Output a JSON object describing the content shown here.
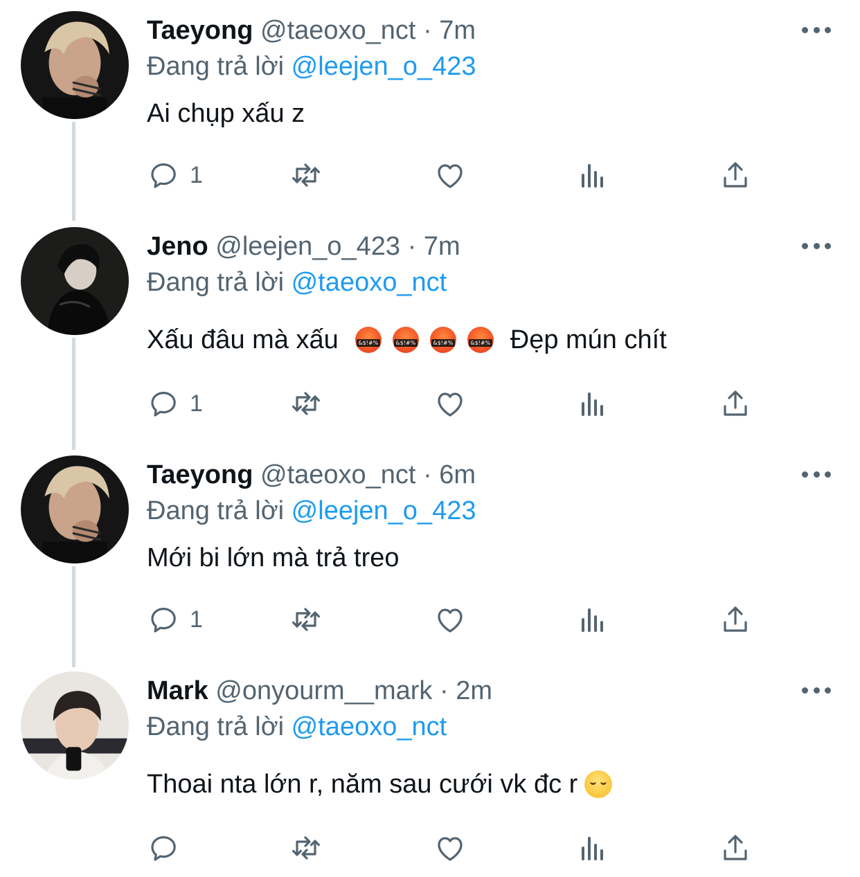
{
  "colors": {
    "link": "#1d9bf0",
    "muted": "#536471",
    "text": "#0f1419",
    "thread_line": "#cfd9de"
  },
  "tweets": [
    {
      "name": "Taeyong",
      "handle": "@taeoxo_nct",
      "dot": "·",
      "time": "7m",
      "reply_prefix": "Đang trả lời",
      "reply_to": "@leejen_o_423",
      "text_before": "Ai chụp xấu z",
      "emojis": [],
      "text_after": "",
      "reply_count": "1",
      "avatar": "taeyong-avatar"
    },
    {
      "name": "Jeno",
      "handle": "@leejen_o_423",
      "dot": "·",
      "time": "7m",
      "reply_prefix": "Đang trả lời",
      "reply_to": "@taeoxo_nct",
      "text_before": "Xấu đâu mà xấu",
      "emojis": [
        "face-with-symbols-on-mouth",
        "face-with-symbols-on-mouth",
        "face-with-symbols-on-mouth",
        "face-with-symbols-on-mouth"
      ],
      "text_after": "Đẹp mún chít",
      "reply_count": "1",
      "avatar": "jeno-avatar"
    },
    {
      "name": "Taeyong",
      "handle": "@taeoxo_nct",
      "dot": "·",
      "time": "6m",
      "reply_prefix": "Đang trả lời",
      "reply_to": "@leejen_o_423",
      "text_before": "Mới bi lớn mà trả treo",
      "emojis": [],
      "text_after": "",
      "reply_count": "1",
      "avatar": "taeyong-avatar"
    },
    {
      "name": "Mark",
      "handle": "@onyourm__mark",
      "dot": "·",
      "time": "2m",
      "reply_prefix": "Đang trả lời",
      "reply_to": "@taeoxo_nct",
      "text_before": "Thoai nta lớn r, năm sau cưới vk đc r",
      "emojis": [
        "relieved-face"
      ],
      "text_after": "",
      "reply_count": "",
      "avatar": "mark-avatar"
    }
  ],
  "action_icons": [
    "reply-icon",
    "retweet-icon",
    "like-icon",
    "views-icon",
    "share-icon"
  ]
}
